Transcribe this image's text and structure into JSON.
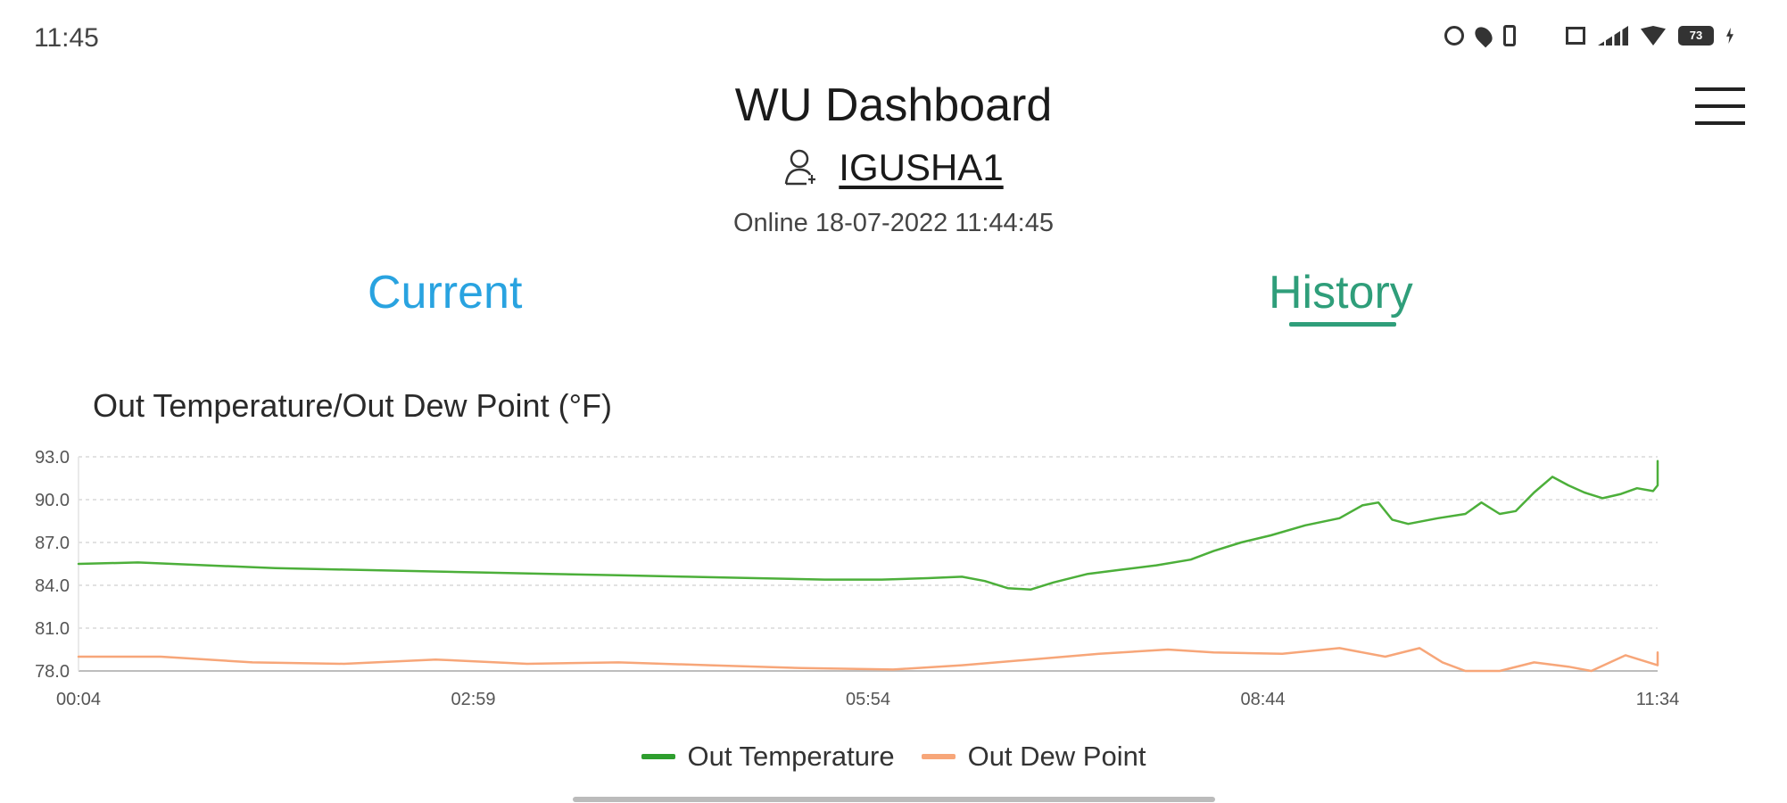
{
  "status_bar": {
    "time": "11:45",
    "battery": "73",
    "icons": [
      "alarm-icon",
      "location-icon",
      "vibrate-icon",
      "data-speed-icon",
      "cast-icon",
      "signal-icon",
      "wifi-icon",
      "battery-icon",
      "charging-icon"
    ]
  },
  "header": {
    "title": "WU Dashboard",
    "station_id": "IGUSHA1",
    "online_status": "Online 18-07-2022 11:44:45",
    "menu_icon": "hamburger-menu-icon",
    "user_icon": "user-icon"
  },
  "tabs": {
    "current": "Current",
    "history": "History",
    "active": "History"
  },
  "colors": {
    "current_tab": "#29a3e0",
    "history_tab": "#2f9e7a",
    "temperature_line": "#4caf3a",
    "dew_point_line": "#f7a679",
    "grid": "#d9d9d9"
  },
  "chart_data": {
    "type": "line",
    "title": "Out Temperature/Out Dew Point (°F)",
    "xlabel": "",
    "ylabel": "",
    "x_ticks": [
      "00:04",
      "02:59",
      "05:54",
      "08:44",
      "11:34"
    ],
    "y_ticks": [
      "78.0",
      "81.0",
      "84.0",
      "87.0",
      "90.0",
      "93.0"
    ],
    "ylim": [
      78,
      93
    ],
    "x_range_minutes": [
      4,
      694
    ],
    "grid": true,
    "legend_position": "bottom",
    "series": [
      {
        "name": "Out Temperature",
        "color": "#4caf3a",
        "points": [
          [
            4,
            85.5
          ],
          [
            30,
            85.6
          ],
          [
            60,
            85.4
          ],
          [
            90,
            85.2
          ],
          [
            120,
            85.1
          ],
          [
            150,
            85.0
          ],
          [
            180,
            84.9
          ],
          [
            210,
            84.8
          ],
          [
            240,
            84.7
          ],
          [
            270,
            84.6
          ],
          [
            300,
            84.5
          ],
          [
            330,
            84.4
          ],
          [
            355,
            84.4
          ],
          [
            375,
            84.5
          ],
          [
            390,
            84.6
          ],
          [
            400,
            84.3
          ],
          [
            410,
            83.8
          ],
          [
            420,
            83.7
          ],
          [
            430,
            84.2
          ],
          [
            445,
            84.8
          ],
          [
            460,
            85.1
          ],
          [
            475,
            85.4
          ],
          [
            490,
            85.8
          ],
          [
            500,
            86.4
          ],
          [
            512,
            87.0
          ],
          [
            525,
            87.5
          ],
          [
            540,
            88.2
          ],
          [
            555,
            88.7
          ],
          [
            565,
            89.6
          ],
          [
            572,
            89.8
          ],
          [
            578,
            88.6
          ],
          [
            585,
            88.3
          ],
          [
            598,
            88.7
          ],
          [
            610,
            89.0
          ],
          [
            617,
            89.8
          ],
          [
            625,
            89.0
          ],
          [
            632,
            89.2
          ],
          [
            640,
            90.5
          ],
          [
            648,
            91.6
          ],
          [
            655,
            91.0
          ],
          [
            662,
            90.5
          ],
          [
            670,
            90.1
          ],
          [
            678,
            90.4
          ],
          [
            685,
            90.8
          ],
          [
            692,
            90.6
          ],
          [
            700,
            91.0
          ],
          [
            708,
            91.2
          ],
          [
            715,
            91.6
          ],
          [
            722,
            92.7
          ],
          [
            728,
            92.3
          ],
          [
            735,
            92.4
          ],
          [
            742,
            92.2
          ]
        ]
      },
      {
        "name": "Out Dew Point",
        "color": "#f7a679",
        "points": [
          [
            4,
            79.0
          ],
          [
            40,
            79.0
          ],
          [
            80,
            78.6
          ],
          [
            120,
            78.5
          ],
          [
            160,
            78.8
          ],
          [
            200,
            78.5
          ],
          [
            240,
            78.6
          ],
          [
            280,
            78.4
          ],
          [
            320,
            78.2
          ],
          [
            360,
            78.1
          ],
          [
            390,
            78.4
          ],
          [
            420,
            78.8
          ],
          [
            450,
            79.2
          ],
          [
            480,
            79.5
          ],
          [
            500,
            79.3
          ],
          [
            530,
            79.2
          ],
          [
            555,
            79.6
          ],
          [
            575,
            79.0
          ],
          [
            590,
            79.6
          ],
          [
            600,
            78.6
          ],
          [
            610,
            78.0
          ],
          [
            625,
            78.0
          ],
          [
            640,
            78.6
          ],
          [
            655,
            78.3
          ],
          [
            665,
            78.0
          ],
          [
            680,
            79.1
          ],
          [
            695,
            78.4
          ],
          [
            710,
            78.5
          ],
          [
            725,
            78.7
          ],
          [
            735,
            78.8
          ],
          [
            742,
            79.3
          ],
          [
            750,
            78.9
          ],
          [
            760,
            79.0
          ]
        ]
      }
    ]
  }
}
